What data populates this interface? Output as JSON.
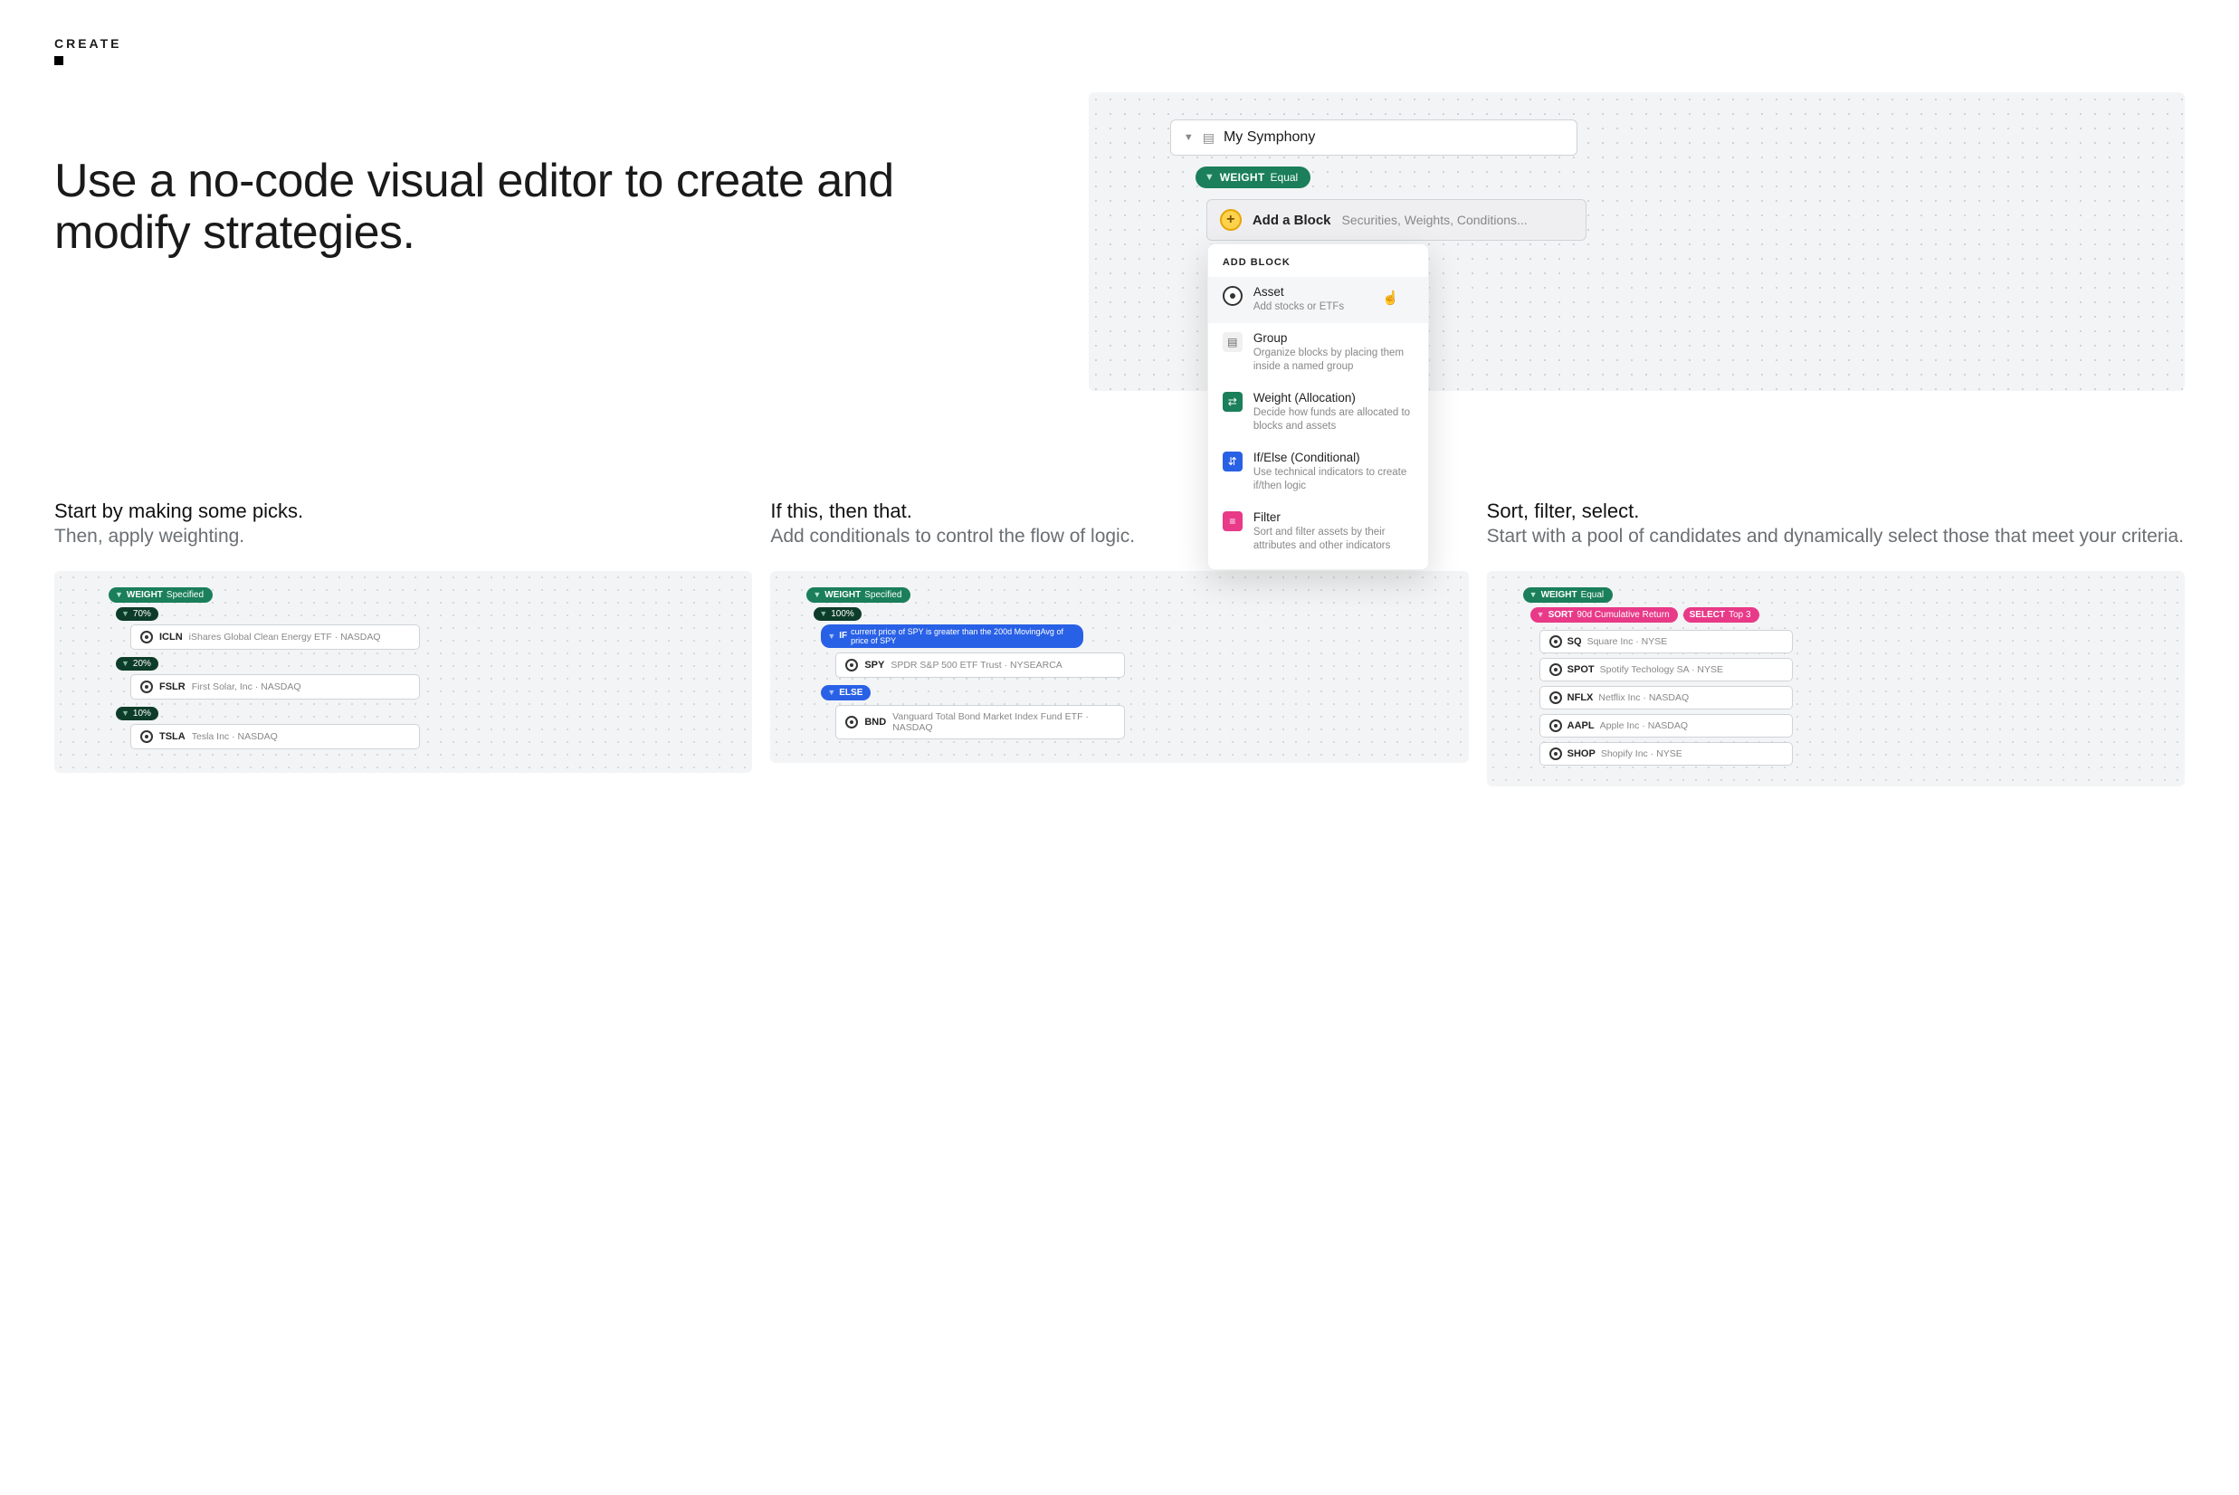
{
  "section_label": "CREATE",
  "hero_title": "Use a no-code visual editor to create and modify strategies.",
  "editor": {
    "root_name": "My Symphony",
    "weight_label": "WEIGHT",
    "weight_mode": "Equal",
    "add_block_label": "Add a Block",
    "add_block_placeholder": "Securities, Weights, Conditions...",
    "dd_header": "ADD BLOCK",
    "items": [
      {
        "title": "Asset",
        "desc": "Add stocks or ETFs"
      },
      {
        "title": "Group",
        "desc": "Organize blocks by placing them inside a named group"
      },
      {
        "title": "Weight (Allocation)",
        "desc": "Decide how funds are allocated to blocks and assets"
      },
      {
        "title": "If/Else (Conditional)",
        "desc": "Use technical indicators to create if/then logic"
      },
      {
        "title": "Filter",
        "desc": "Sort and filter assets by their attributes and other indicators"
      }
    ]
  },
  "features": [
    {
      "title": "Start by making some picks.",
      "sub": "Then, apply weighting.",
      "weight_label": "WEIGHT",
      "weight_mode": "Specified",
      "rows": [
        {
          "pct": "70%",
          "ticker": "ICLN",
          "name": "iShares Global Clean Energy ETF · NASDAQ"
        },
        {
          "pct": "20%",
          "ticker": "FSLR",
          "name": "First Solar, Inc · NASDAQ"
        },
        {
          "pct": "10%",
          "ticker": "TSLA",
          "name": "Tesla Inc · NASDAQ"
        }
      ]
    },
    {
      "title": "If this, then that.",
      "sub": "Add conditionals to control the flow of logic.",
      "weight_label": "WEIGHT",
      "weight_mode": "Specified",
      "pct": "100%",
      "if_label": "IF",
      "if_text": "current price of SPY is greater than the 200d MovingAvg of price of SPY",
      "then_ticker": "SPY",
      "then_name": "SPDR S&P 500 ETF Trust · NYSEARCA",
      "else_label": "ELSE",
      "else_ticker": "BND",
      "else_name": "Vanguard Total Bond Market Index Fund ETF · NASDAQ"
    },
    {
      "title": "Sort, filter, select.",
      "sub": "Start with a pool of candidates and dynamically select those that meet your criteria.",
      "weight_label": "WEIGHT",
      "weight_mode": "Equal",
      "sort_label": "SORT",
      "sort_value": "90d Cumulative Return",
      "select_label": "SELECT",
      "select_value": "Top 3",
      "assets": [
        {
          "ticker": "SQ",
          "name": "Square Inc · NYSE"
        },
        {
          "ticker": "SPOT",
          "name": "Spotify Techology SA · NYSE"
        },
        {
          "ticker": "NFLX",
          "name": "Netflix Inc · NASDAQ"
        },
        {
          "ticker": "AAPL",
          "name": "Apple Inc · NASDAQ"
        },
        {
          "ticker": "SHOP",
          "name": "Shopify Inc · NYSE"
        }
      ]
    }
  ]
}
